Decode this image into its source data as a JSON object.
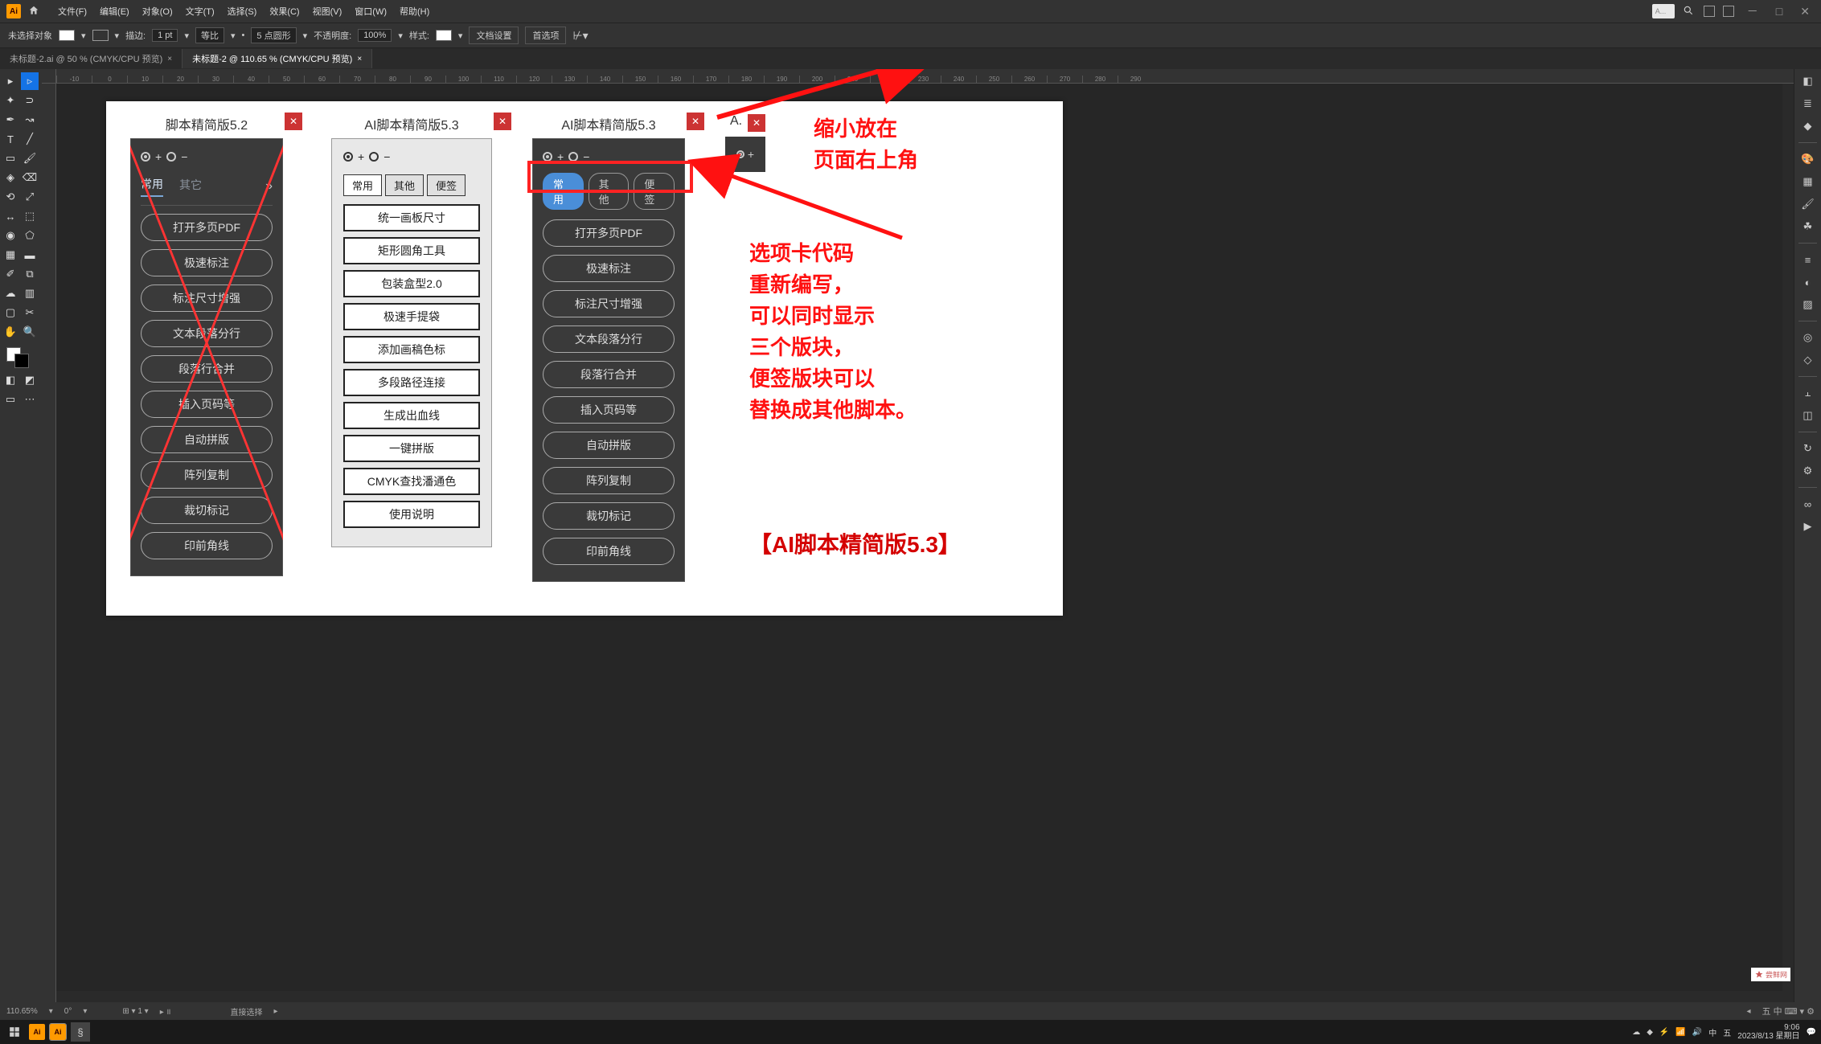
{
  "menubar": {
    "items": [
      "文件(F)",
      "编辑(E)",
      "对象(O)",
      "文字(T)",
      "选择(S)",
      "效果(C)",
      "视图(V)",
      "窗口(W)",
      "帮助(H)"
    ],
    "search_placeholder": "A..."
  },
  "controlbar": {
    "noselection": "未选择对象",
    "stroke_label": "描边:",
    "stroke_value": "1 pt",
    "uniform": "等比",
    "brush_label": "5 点圆形",
    "opacity_label": "不透明度:",
    "opacity_value": "100%",
    "style_label": "样式:",
    "docset": "文档设置",
    "prefs": "首选项"
  },
  "tabs": [
    {
      "label": "未标题-2.ai @ 50 % (CMYK/CPU 预览)",
      "active": false
    },
    {
      "label": "未标题-2 @ 110.65 % (CMYK/CPU 预览)",
      "active": true
    }
  ],
  "ruler_values": [
    "-10",
    "0",
    "10",
    "20",
    "30",
    "40",
    "50",
    "60",
    "70",
    "80",
    "90",
    "100",
    "110",
    "120",
    "130",
    "140",
    "150",
    "160",
    "170",
    "180",
    "190",
    "200",
    "210",
    "220",
    "230",
    "240",
    "250",
    "260",
    "270",
    "280",
    "290"
  ],
  "panel1": {
    "title": "脚本精简版5.2",
    "tabs": [
      "常用",
      "其它"
    ],
    "buttons": [
      "打开多页PDF",
      "极速标注",
      "标注尺寸增强",
      "文本段落分行",
      "段落行合并",
      "插入页码等",
      "自动拼版",
      "阵列复制",
      "裁切标记",
      "印前角线"
    ]
  },
  "panel2": {
    "title": "AI脚本精简版5.3",
    "tabs": [
      "常用",
      "其他",
      "便签"
    ],
    "buttons": [
      "统一画板尺寸",
      "矩形圆角工具",
      "包装盒型2.0",
      "极速手提袋",
      "添加画稿色标",
      "多段路径连接",
      "生成出血线",
      "一键拼版",
      "CMYK查找潘通色",
      "使用说明"
    ]
  },
  "panel3": {
    "title": "AI脚本精简版5.3",
    "tabs": [
      "常用",
      "其他",
      "便签"
    ],
    "buttons": [
      "打开多页PDF",
      "极速标注",
      "标注尺寸增强",
      "文本段落分行",
      "段落行合并",
      "插入页码等",
      "自动拼版",
      "阵列复制",
      "裁切标记",
      "印前角线"
    ]
  },
  "panel4": {
    "title": "A."
  },
  "anno_top": "缩小放在\n页面右上角",
  "anno_mid": "选项卡代码\n重新编写，\n可以同时显示\n三个版块，\n便签版块可以\n替换成其他脚本。",
  "anno_footer": "【AI脚本精简版5.3】",
  "status": {
    "zoom": "110.65%",
    "angle": "0°",
    "tool": "直接选择"
  },
  "taskbar": {
    "time": "9:06",
    "date": "2023/8/13 星期日"
  },
  "watermark": "尝鲜网"
}
